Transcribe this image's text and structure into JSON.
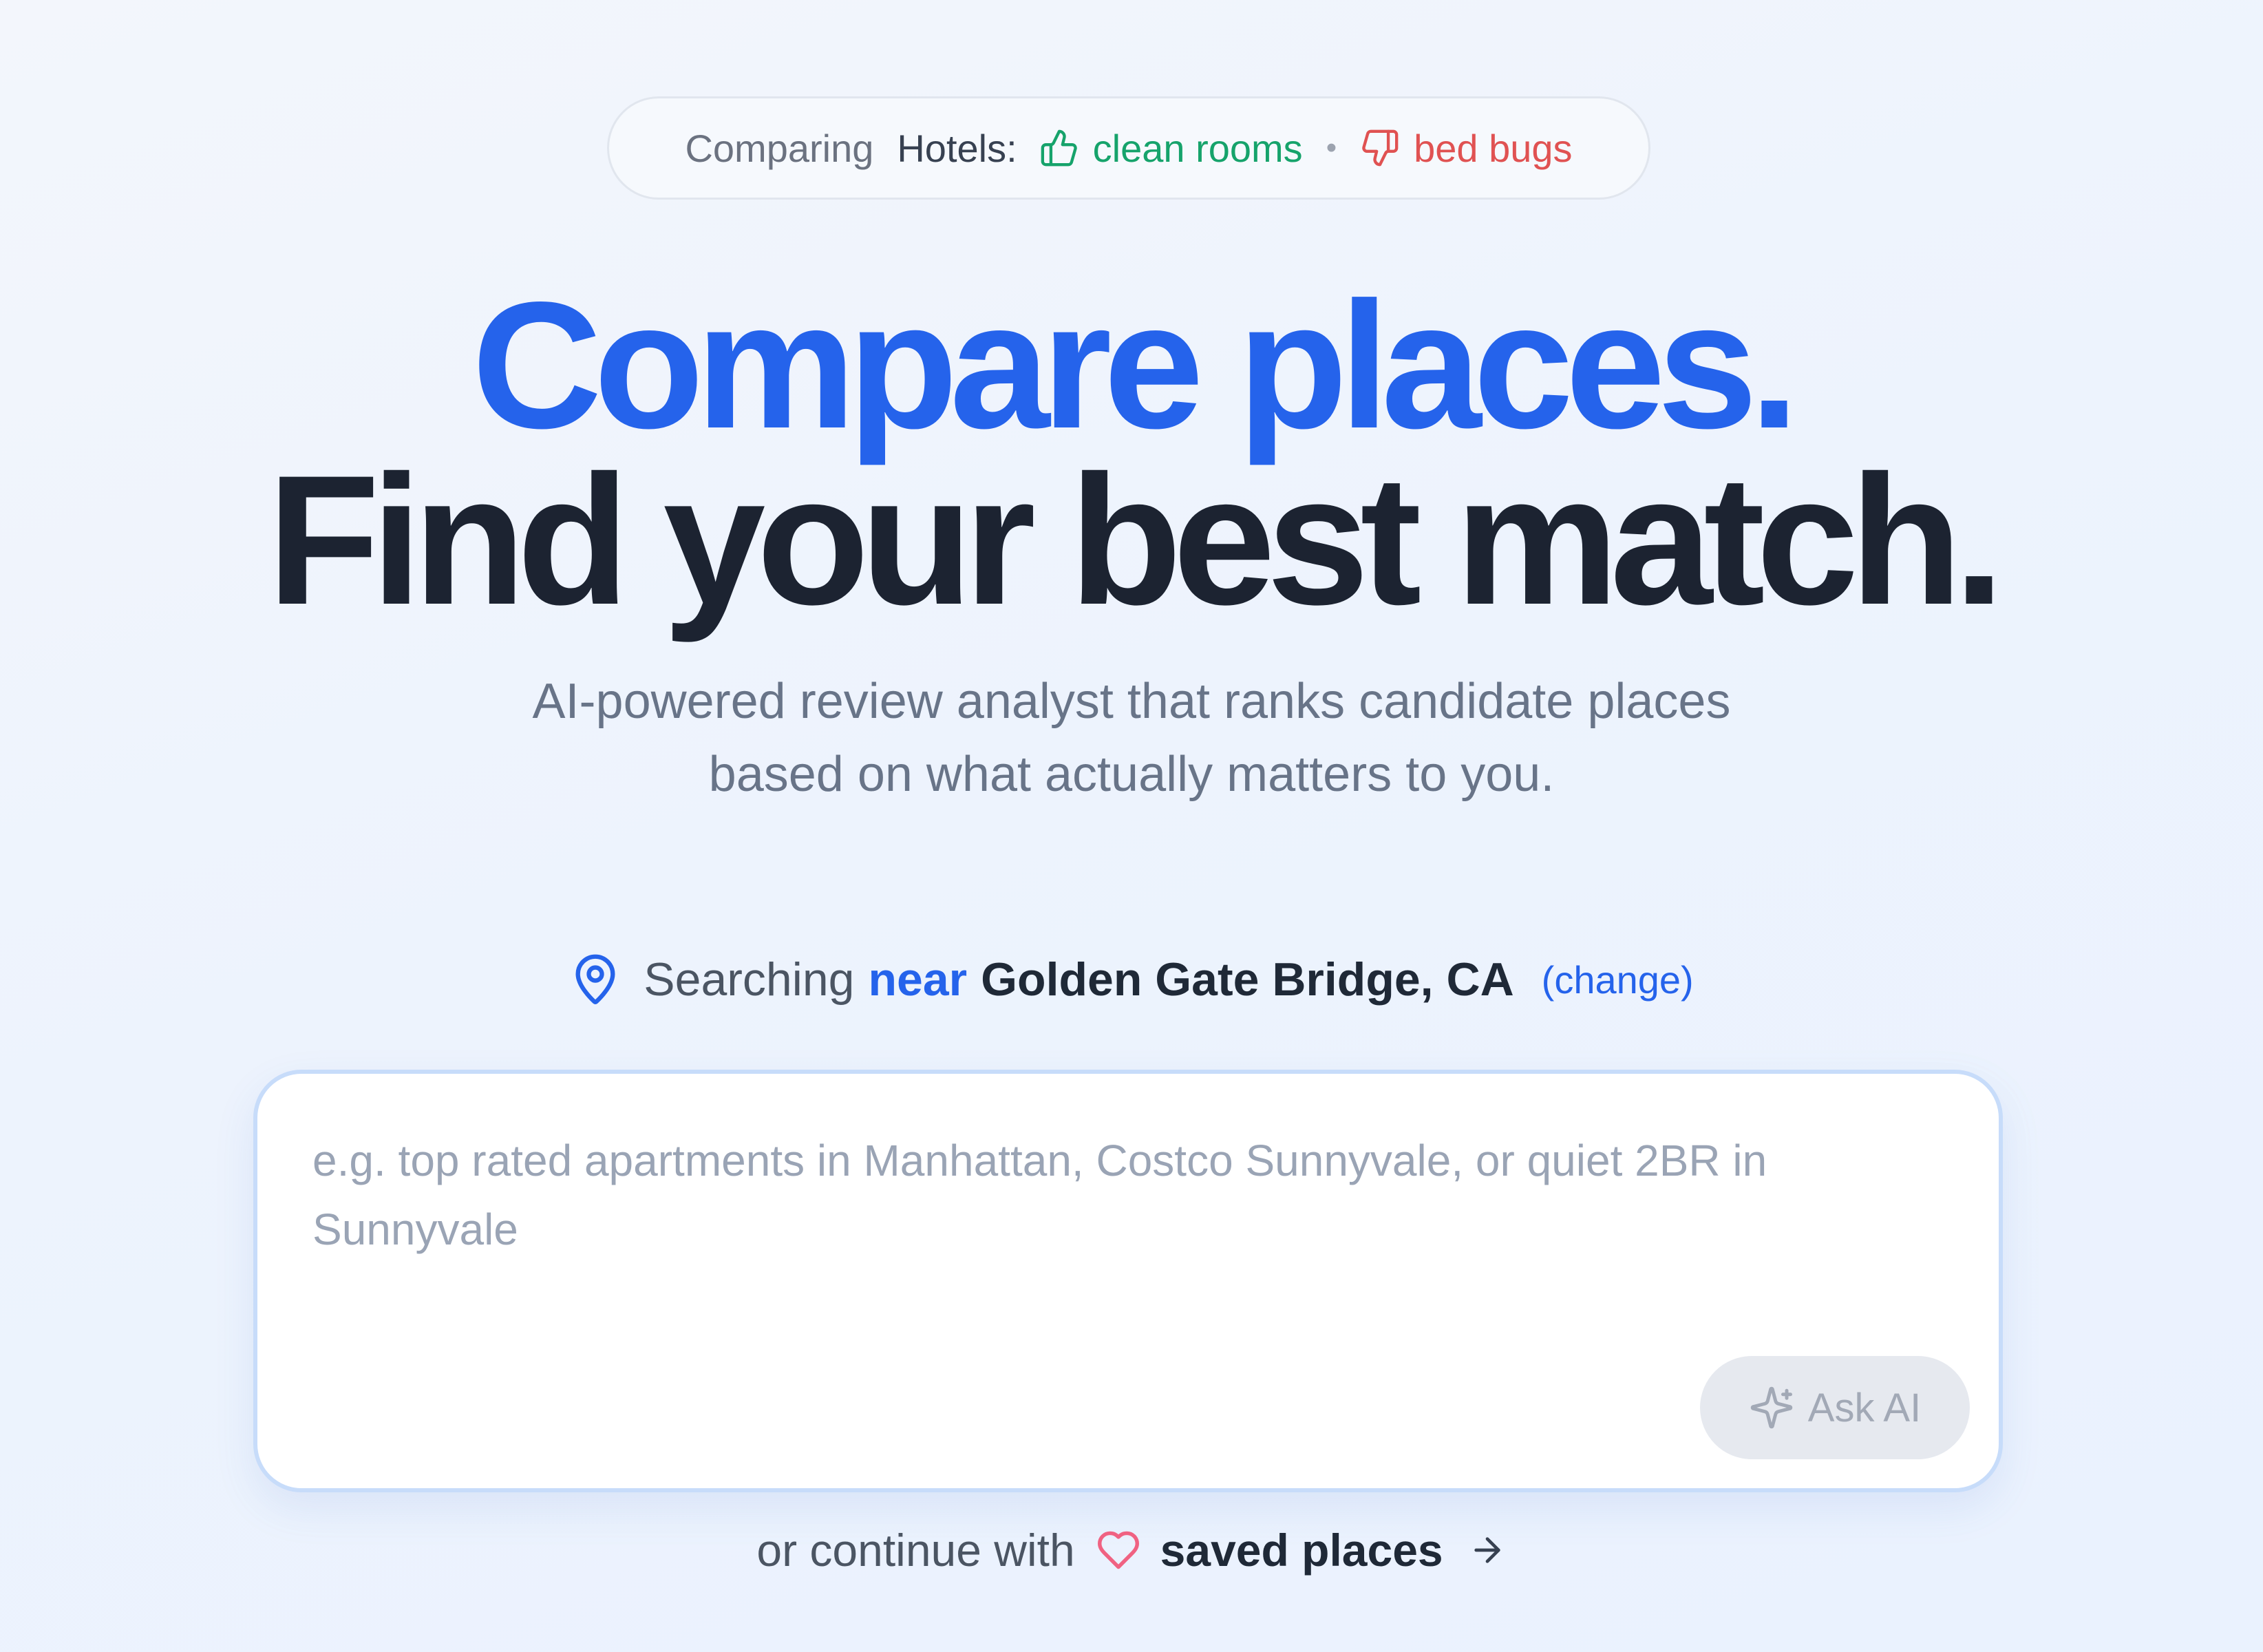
{
  "banner": {
    "prefix": "Comparing",
    "category": "Hotels:",
    "pro_label": "clean rooms",
    "separator": "•",
    "con_label": "bed bugs"
  },
  "headline": {
    "line1": "Compare places.",
    "line2": "Find your best match."
  },
  "subtitle": {
    "line1": "AI-powered review analyst that ranks candidate places",
    "line2": "based on what actually matters to you."
  },
  "location": {
    "prefix": "Searching",
    "near": "near",
    "place": "Golden Gate Bridge, CA",
    "change_label": "(change)"
  },
  "search": {
    "value": "",
    "placeholder": "e.g. top rated apartments in Manhattan, Costco Sunnyvale, or quiet 2BR in Sunnyvale",
    "ask_label": "Ask AI"
  },
  "continue": {
    "prefix": "or continue with",
    "saved_label": "saved places"
  },
  "icons": {
    "pro": "thumbs-up-icon",
    "con": "thumbs-down-icon",
    "location": "map-pin-icon",
    "ask": "sparkle-icon",
    "saved": "heart-icon",
    "continue": "arrow-right-icon"
  },
  "colors": {
    "accent": "#2563eb",
    "heading_dark": "#1c2331",
    "pro": "#16a36b",
    "con": "#e05252",
    "heart": "#f06282",
    "input_border": "#c7dcfa",
    "button_disabled_bg": "#e6e9ef"
  }
}
